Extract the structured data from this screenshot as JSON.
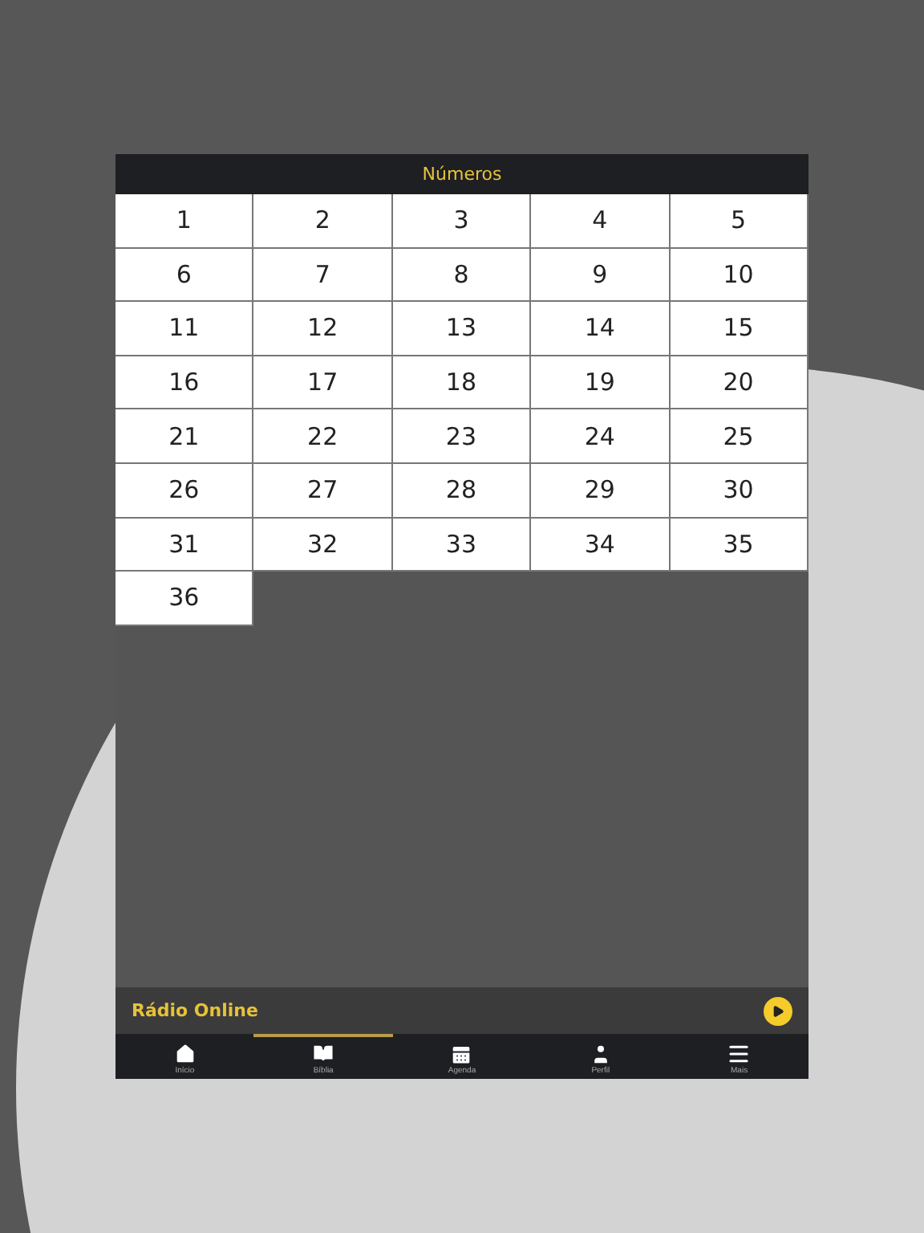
{
  "header": {
    "title": "Números"
  },
  "numbers": [
    "1",
    "2",
    "3",
    "4",
    "5",
    "6",
    "7",
    "8",
    "9",
    "10",
    "11",
    "12",
    "13",
    "14",
    "15",
    "16",
    "17",
    "18",
    "19",
    "20",
    "21",
    "22",
    "23",
    "24",
    "25",
    "26",
    "27",
    "28",
    "29",
    "30",
    "31",
    "32",
    "33",
    "34",
    "35",
    "36"
  ],
  "radio": {
    "label": "Rádio Online"
  },
  "nav": [
    {
      "label": "Início",
      "selected": false
    },
    {
      "label": "Bíblia",
      "selected": true
    },
    {
      "label": "Agenda",
      "selected": false
    },
    {
      "label": "Perfil",
      "selected": false
    },
    {
      "label": "Mais",
      "selected": false
    }
  ]
}
